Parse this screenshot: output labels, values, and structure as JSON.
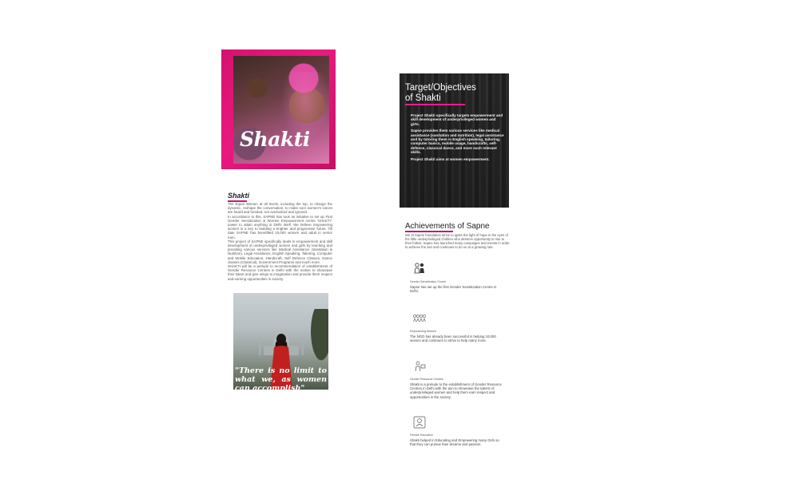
{
  "hero": {
    "title": "Shakti"
  },
  "shakti": {
    "heading": "Shakti",
    "paragraphs": [
      "The Equal Women at all levels, including the top, to change the dynamic, reshape the conversation, to make sure women's voices are heard and heeded, not overlooked and ignored.",
      "In accordance to this, SAPNE has took an initiative to set up First Gender Sensitization & Women Empowerment centre 'SHAKTI'- power to attain anything in Delhi itself. We believe empowering women is a key to building a brighter and progressive future. Till date SAPNE has benefitted 10,000 women and adult in senior men.",
      "This project of SAPNE specifically deals in empowerment and skill development of underprivileged women and girls by teaching and providing various services like Medical Assistance (Sanitation & Nutrition), Legal Assistance, English Speaking, Tailoring, Computer and Mobile Education, Handicraft, Self Defence Classes, Dance classes (Classical), Government Programs and much more.",
      "SHAKTI will be a prelude to recommendation of establishment of Gender Resource Centres in Delhi with the motive to showcase their talent and give wings to imagination and provide them respect and earning opportunities in society."
    ]
  },
  "quote": {
    "text": "\"There is no limit to what we, as women can accomplish\""
  },
  "objectives": {
    "title_line1": "Target/Objectives",
    "title_line2": "of Shakti",
    "paragraphs": [
      "Project Shakti specifically targets empowerment and skill development of underprivileged women and girls.",
      "Sapne provides them various services like medical assistance (sanitation and nutrition), legal assistance and by tutoring them in English speaking, tailoring, computer basics, mobile usage, handicrafts, self-defence, classical dance, and more such relevant skills.",
      "Project Shakti aims at women empowerment."
    ]
  },
  "achievements": {
    "title": "Achievements of Sapne",
    "intro": "We at Sapne foundation strive to ignite the light of hope in the eyes of the little underprivileged children who deserve opportunity to rise to their fullest. Sapne has launched many campaigns and events in order to achieve the aim and continues to do so at a growing rate.",
    "items": [
      {
        "icon": "gender-people-icon",
        "label": "Gender Sensitization Centre",
        "desc": "Sapne has set up the first Gender Sensitization Centre in Delhi."
      },
      {
        "icon": "group-people-icon",
        "label": "Empowering Women",
        "desc": "The NGO has already been successful in helping 10,000 women and continues to strive to help many more."
      },
      {
        "icon": "resource-center-icon",
        "label": "Gender Resource Centres",
        "desc": "Shakti is a prelude to the establishment of Gender Resource Centres in Delhi with the aim to showcase the talents of underprivileged women and help them earn respect and opportunities in the society."
      },
      {
        "icon": "female-education-icon",
        "label": "Female Education",
        "desc": "Shakti helped in Educating and Empowering many Girls so that they can pursue their dreams and passion."
      }
    ]
  },
  "colors": {
    "accent": "#e91e8c",
    "hero_bg": "#d4126f"
  }
}
